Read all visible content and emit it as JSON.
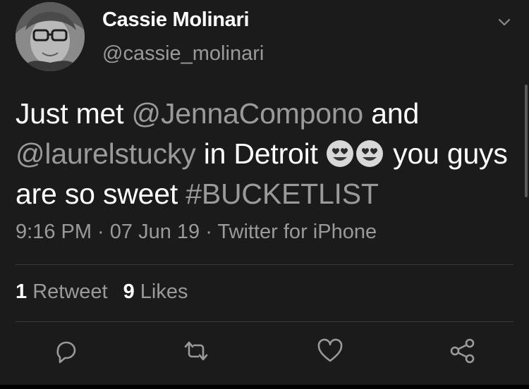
{
  "author": {
    "name": "Cassie Molinari",
    "handle": "@cassie_molinari"
  },
  "tweet": {
    "segments": {
      "s1": "Just met ",
      "s2": "@JennaCompono",
      "s3": " and ",
      "s4": "@laurelstucky",
      "s5": " in Detroit ",
      "s6": " you guys are so sweet ",
      "s7": "#BUCKETLIST"
    },
    "emojis": [
      "heart-eyes-emoji",
      "heart-eyes-emoji"
    ]
  },
  "meta": {
    "time": "9:16 PM",
    "sep1": " · ",
    "date": "07 Jun 19",
    "sep2": " · ",
    "source": "Twitter for iPhone"
  },
  "stats": {
    "retweets_count": "1",
    "retweets_label": " Retweet",
    "likes_count": "9",
    "likes_label": " Likes"
  },
  "actions": {
    "icons": [
      "reply-icon",
      "retweet-icon",
      "like-icon",
      "share-icon"
    ]
  },
  "colors": {
    "background": "#1b1b1b",
    "text": "#ffffff",
    "secondary": "#9a9a9a",
    "divider": "#3a3a3a"
  }
}
